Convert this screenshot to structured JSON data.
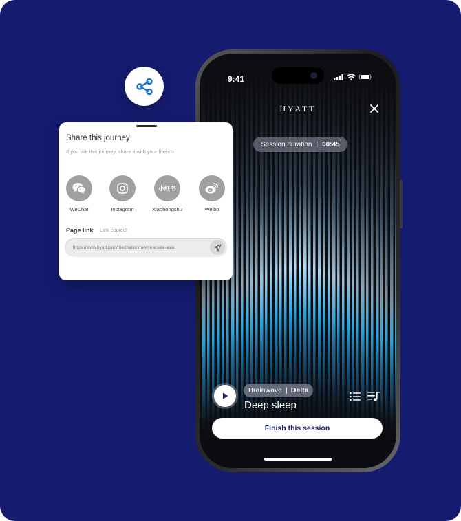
{
  "phone": {
    "status_time": "9:41",
    "brand_logo": "HYATT",
    "close_icon": "close-icon",
    "session_duration": {
      "label": "Session duration",
      "separator": "|",
      "value": "00:45"
    },
    "track": {
      "category": "Brainwave",
      "separator": "|",
      "type": "Delta",
      "title": "Deep sleep"
    },
    "finish_button": "Finish this session",
    "icons": [
      "play-icon",
      "list-icon",
      "playlist-icon",
      "signal-icon",
      "wifi-icon",
      "battery-icon"
    ]
  },
  "share_bubble": {
    "icon": "share-icon",
    "color": "#1e73d2"
  },
  "share_card": {
    "title": "Share this journey",
    "subtitle": "If you like this journey, share it with your friends",
    "options": [
      {
        "label": "WeChat",
        "icon": "wechat-icon"
      },
      {
        "label": "Instagram",
        "icon": "instagram-icon"
      },
      {
        "label": "Xiaohongshu",
        "icon": "xiaohongshu-icon",
        "glyph": "小红书"
      },
      {
        "label": "Weibo",
        "icon": "weibo-icon"
      }
    ],
    "page_link_label": "Page link",
    "link_copied": "Link copied!",
    "link_value": "https://www.hyatt.com/meditation/newyearsale-asia",
    "send_icon": "send-icon"
  },
  "colors": {
    "background": "#151c6f",
    "button_text": "#1a2166",
    "share_blue": "#1e73d2",
    "social_grey": "#a0a0a0"
  }
}
